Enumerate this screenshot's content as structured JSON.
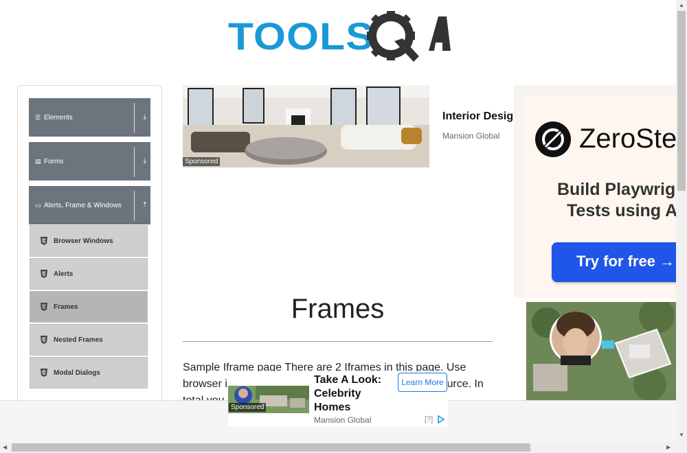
{
  "logo": {
    "text_tools": "TOOLS",
    "text_qa": "QA"
  },
  "sidebar": {
    "groups": [
      {
        "label": "Elements",
        "icon": "hamburger-icon",
        "arrow": "download-arrow-icon"
      },
      {
        "label": "Forms",
        "icon": "form-icon",
        "arrow": "download-arrow-icon"
      },
      {
        "label": "Alerts, Frame & Windows",
        "icon": "window-icon",
        "arrow": "upload-arrow-icon"
      }
    ],
    "items": [
      {
        "label": "Browser Windows",
        "icon": "html5-icon"
      },
      {
        "label": "Alerts",
        "icon": "html5-icon"
      },
      {
        "label": "Frames",
        "icon": "html5-icon",
        "active": true
      },
      {
        "label": "Nested Frames",
        "icon": "html5-icon"
      },
      {
        "label": "Modal Dialogs",
        "icon": "html5-icon"
      }
    ]
  },
  "top_ad": {
    "sponsored": "Sponsored",
    "title": "Interior Design",
    "source": "Mansion Global"
  },
  "right_ad": {
    "brand": "ZeroStep",
    "line1": "Build Playwright",
    "line2": "Tests using AI",
    "cta": "Try for free →"
  },
  "main": {
    "title": "Frames",
    "intro": "Sample Iframe page There are 2 Iframes in this page. Use browser inspecter or firebug to check out the HTML source. In total you can switch between the parent frame, as this"
  },
  "bottom_ad": {
    "sponsored": "Sponsored",
    "title": "Take A Look: Celebrity Homes",
    "source": "Mansion Global",
    "cta": "Learn More",
    "help": "[?]"
  },
  "colors": {
    "logo_blue": "#1a99d6",
    "logo_dark": "#333333",
    "sidebar_header": "#6c757d",
    "menu_item": "#cfcfcf",
    "menu_item_active": "#b5b5b5",
    "cta_blue": "#1f55e8",
    "link_blue": "#1a73e8"
  }
}
